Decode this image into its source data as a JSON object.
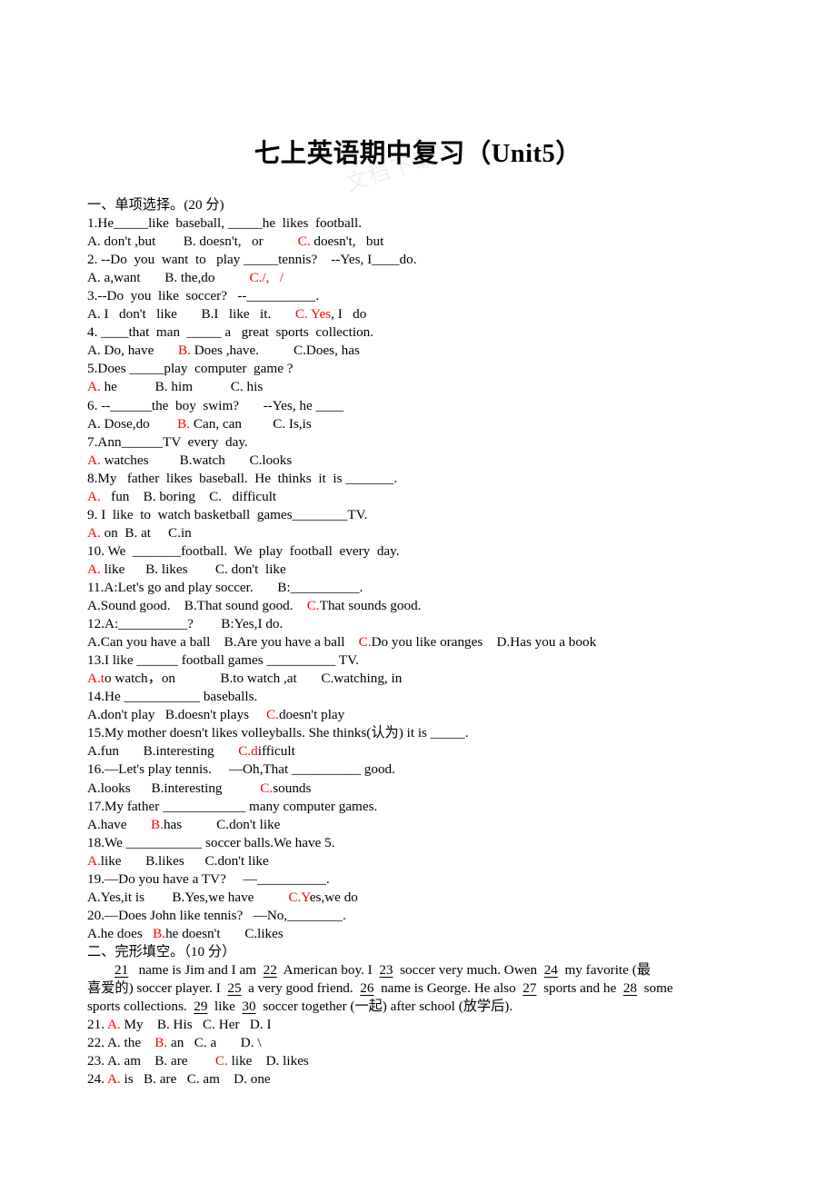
{
  "document": {
    "title": "七上英语期中复习（Unit5）",
    "watermark": "文档下载"
  },
  "section1": {
    "heading": "一、单项选择。(20 分)",
    "questions": [
      {
        "stem_parts": [
          "1.He",
          "BLANK5",
          "like   baseball,",
          "BLANK5",
          "he   likes   football."
        ],
        "stem": "1.He_____like  baseball, _____he  likes  football.",
        "options_line": "A. don't ,but        B. doesn't,   or          C. doesn't,   but",
        "answer": "C"
      },
      {
        "stem": "2. --Do  you  want  to   play _____tennis?    --Yes, I____do.",
        "options_line": "A. a,want       B. the,do           C./,   /",
        "answer": "C"
      },
      {
        "stem": "3.--Do  you  like  soccer?   --__________.",
        "options_line": "A. I  don't  like        B.I  like  it.        C. Yes, I  do",
        "answer": "C"
      },
      {
        "stem": "4. ____that  man  _____ a   great  sports  collection.",
        "options_line": "A. Do, have        B. Does ,have.          C.Does, has",
        "answer": "B"
      },
      {
        "stem": "5.Does _____play  computer  game ?",
        "options_line": "A. he           B. him           C. his",
        "answer": "A"
      },
      {
        "stem": "6. --______the  boy  swim?       --Yes, he ____",
        "options_line": "A. Dose,do        B. Can, can         C. Is,is",
        "answer": "B"
      },
      {
        "stem": "7.Ann______TV  every  day.",
        "options_line": "A. watches         B.watch       C.looks",
        "answer": "A"
      },
      {
        "stem": "8.My   father  likes  baseball.  He  thinks  it  is _______.",
        "options_line": "A.   fun    B. boring    C.   difficult",
        "answer": "A"
      },
      {
        "stem": "9. I  like  to  watch basketball  games________TV.",
        "options_line": "A. on  B. at     C.in",
        "answer": "A"
      },
      {
        "stem": "10. We  _______football.  We  play  football  every  day.",
        "options_line": "A. like      B. likes        C. don't  like",
        "answer": "A"
      },
      {
        "stem": "11.A:Let's go and play soccer.       B:__________.",
        "options_line": "A.Sound good.    B.That sound good.    C.That sounds good.",
        "answer": "C"
      },
      {
        "stem": "12.A:__________?        B:Yes,I do.",
        "options_line": "A.Can you have a ball    B.Are you have a ball    C.Do you like oranges    D.Has you a book",
        "answer": "C"
      },
      {
        "stem": "13.I like ______ football games __________ TV.",
        "options_line": "A.to watch，on             B.to watch ,at       C.watching, in",
        "answer": "A"
      },
      {
        "stem": "14.He ___________ baseballs.",
        "options_line": "A.don't play   B.doesn't plays     C.doesn't play",
        "answer": "C"
      },
      {
        "stem": "15.My mother doesn't likes volleyballs. She thinks(认为) it is _____.",
        "options_line": "A.fun       B.interesting       C.difficult",
        "answer": "C"
      },
      {
        "stem": "16.—Let's play tennis.     —Oh,That __________ good.",
        "options_line": "A.looks      B.interesting           C.sounds",
        "answer": "C"
      },
      {
        "stem": "17.My father ____________ many computer games.",
        "options_line": "A.have       B.has          C.don't like",
        "answer": "B"
      },
      {
        "stem": "18.We ___________ soccer balls.We have 5.",
        "options_line": "A.like       B.likes      C.don't like",
        "answer": "A"
      },
      {
        "stem": "19.—Do you have a TV?     —__________.",
        "options_line": "A.Yes,it is        B.Yes,we have          C.Yes,we do",
        "answer": "C"
      },
      {
        "stem": "20.—Does John like tennis?   —No,________.",
        "options_line": "A.he does   B.he doesn't       C.likes",
        "answer": "B"
      }
    ]
  },
  "section2": {
    "heading": "二、完形填空。（10 分）",
    "passage_line1": "__21__  name is Jim and I am  __22__  American boy. I  __23__  soccer very much. Owen  __24__  my favorite (最",
    "passage_line2": "喜爱的) soccer player. I  __25__  a very good friend.  __26__  name is George. He also  __27__  sports and he  __28__  some",
    "passage_line3": "sports collections.  __29__  like  __30__  soccer together (一起) after school (放学后).",
    "blanks": [
      "21",
      "22",
      "23",
      "24",
      "25",
      "26",
      "27",
      "28",
      "29",
      "30"
    ],
    "questions": [
      {
        "num": "21.",
        "options_line": "A. My    B. His   C. Her   D. I",
        "answer": "A"
      },
      {
        "num": "22.",
        "options_line": "A. the    B. an   C. a       D. \\",
        "answer": "B"
      },
      {
        "num": "23.",
        "options_line": "A. am    B. are        C. like    D. likes",
        "answer": "C"
      },
      {
        "num": "24.",
        "options_line": "A. is   B. are   C. am    D. one",
        "answer": "A"
      }
    ]
  }
}
